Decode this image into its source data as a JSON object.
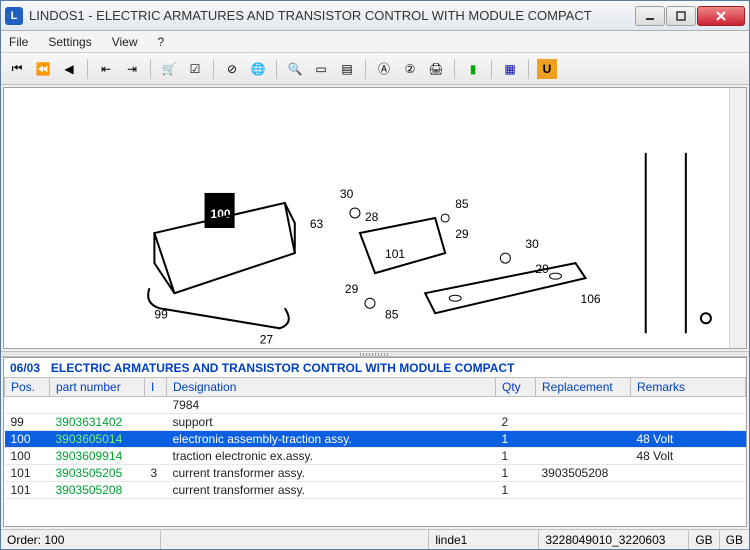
{
  "window": {
    "title": "LINDOS1 - ELECTRIC ARMATURES AND TRANSISTOR CONTROL WITH MODULE COMPACT"
  },
  "menu": {
    "file": "File",
    "settings": "Settings",
    "view": "View",
    "help": "?"
  },
  "diagram_labels": [
    "100",
    "63",
    "30",
    "28",
    "85",
    "29",
    "101",
    "30",
    "29",
    "99",
    "27",
    "106",
    "29",
    "85"
  ],
  "section": {
    "code": "06/03",
    "title": "ELECTRIC ARMATURES AND TRANSISTOR CONTROL WITH MODULE COMPACT"
  },
  "columns": {
    "pos": "Pos.",
    "part": "part number",
    "i": "I",
    "desig": "Designation",
    "qty": "Qty",
    "repl": "Replacement",
    "rem": "Remarks"
  },
  "rows": [
    {
      "pos": "",
      "part": "",
      "i": "",
      "desig": "7984",
      "qty": "",
      "repl": "",
      "rem": "",
      "sel": false
    },
    {
      "pos": "99",
      "part": "3903631402",
      "i": "",
      "desig": "support",
      "qty": "2",
      "repl": "",
      "rem": "",
      "sel": false
    },
    {
      "pos": "100",
      "part": "3903605014",
      "i": "",
      "desig": "electronic assembly-traction assy.",
      "qty": "1",
      "repl": "",
      "rem": "48 Volt",
      "sel": true
    },
    {
      "pos": "100",
      "part": "3903609914",
      "i": "",
      "desig": "traction electronic ex.assy.",
      "qty": "1",
      "repl": "",
      "rem": "48 Volt",
      "sel": false
    },
    {
      "pos": "101",
      "part": "3903505205",
      "i": "3",
      "desig": "current transformer assy.",
      "qty": "1",
      "repl": "3903505208",
      "rem": "",
      "sel": false
    },
    {
      "pos": "101",
      "part": "3903505208",
      "i": "",
      "desig": "current transformer assy.",
      "qty": "1",
      "repl": "",
      "rem": "",
      "sel": false
    }
  ],
  "status": {
    "order_label": "Order:",
    "order_value": "100",
    "user": "linde1",
    "code": "3228049010_3220603",
    "gb1": "GB",
    "gb2": "GB"
  }
}
